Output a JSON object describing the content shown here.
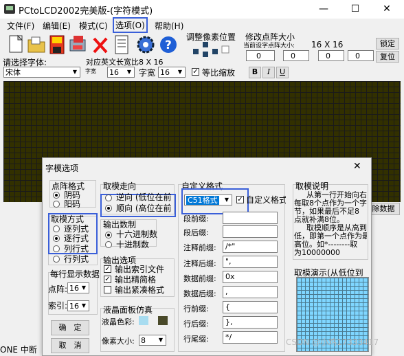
{
  "window": {
    "title": "PCtoLCD2002完美版-(字符模式)",
    "controls": {
      "minimize": "—",
      "maximize": "☐",
      "close": "✕"
    }
  },
  "menu": {
    "file": "文件(F)",
    "edit": "编辑(E)",
    "mode": "模式(C)",
    "options": "选项(O)",
    "help": "帮助(H)"
  },
  "toolbar": {
    "adjust_title": "调整像素位置",
    "dot_title": "修改点阵大小",
    "dot_sub": "当前设字点阵大小:",
    "dot_size": "16 X 16",
    "lock_label": "锁定",
    "reset_label": "复位",
    "spin_values": [
      "0",
      "0",
      "0",
      "0"
    ]
  },
  "fontbar": {
    "select_font_label": "请选择字体:",
    "font_value": "宋体",
    "width_label": "对应英文长宽比8 X 16",
    "char_width_label": "字宽",
    "char_width_value": "16",
    "char_height_label": "字高",
    "char_height_value": "16",
    "equal_scale_label": "等比缩放",
    "bold_label": "B",
    "italic_label": "I",
    "underline_label": "U"
  },
  "side_button": "除数据",
  "dialog": {
    "title": "字模选项",
    "close": "✕",
    "dot_format": {
      "title": "点阵格式",
      "options": [
        "阴码",
        "阳码"
      ],
      "selected": 0
    },
    "modulo_mode": {
      "title": "取模方式",
      "options": [
        "逐列式",
        "逐行式",
        "列行式",
        "行列式"
      ],
      "selected": 1
    },
    "modulo_dir": {
      "title": "取模走向",
      "options": [
        "逆向 (低位在前",
        "顺向 (高位在前"
      ],
      "selected": 1
    },
    "output_base": {
      "title": "输出数制",
      "options": [
        "十六进制数",
        "十进制数"
      ],
      "selected": 0
    },
    "output_opts": {
      "title": "输出选项",
      "items": [
        "输出索引文件",
        "输出精简格",
        "输出紧凑格式"
      ],
      "checked": [
        true,
        true,
        false
      ]
    },
    "per_line": {
      "title": "每行显示数据",
      "dots_label": "点阵:",
      "dots_value": "16",
      "index_label": "索引:",
      "index_value": "16"
    },
    "lcd": {
      "title": "液晶面板仿真",
      "color_label": "液晶色彩:",
      "pixel_label": "像素大小:",
      "pixel_value": "8",
      "color1": "#a8dcf0",
      "color2": "#4a4a2a"
    },
    "custom": {
      "title": "自定义格式",
      "format_value": "C51格式",
      "custom_check_label": "自定义格式",
      "custom_checked": true,
      "rows": [
        {
          "label": "段前缀:",
          "value": ""
        },
        {
          "label": "段后缀:",
          "value": ""
        },
        {
          "label": "注释前缀:",
          "value": "/*\""
        },
        {
          "label": "注释后缀:",
          "value": "\","
        },
        {
          "label": "数据前缀:",
          "value": "0x"
        },
        {
          "label": "数据后缀:",
          "value": ","
        },
        {
          "label": "行前缀:",
          "value": "{"
        },
        {
          "label": "行后缀:",
          "value": "},"
        },
        {
          "label": "行尾缀:",
          "value": "*/"
        }
      ]
    },
    "desc": {
      "title": "取模说明",
      "lines": [
        "从第一行开始向右",
        "每取8个点作为一个字",
        "节，如果最后不足8",
        "点就补满8位。",
        "取模顺序是从高到",
        "低，即第一个点作为最",
        "高位。如*--------取",
        "为10000000"
      ]
    },
    "demo": {
      "title": "取模演示(从低位到"
    },
    "ok_label": "确　定",
    "cancel_label": "取　消"
  },
  "watermark": "CSDN @小鸡17333417",
  "bottom_text": "ONE 中断"
}
